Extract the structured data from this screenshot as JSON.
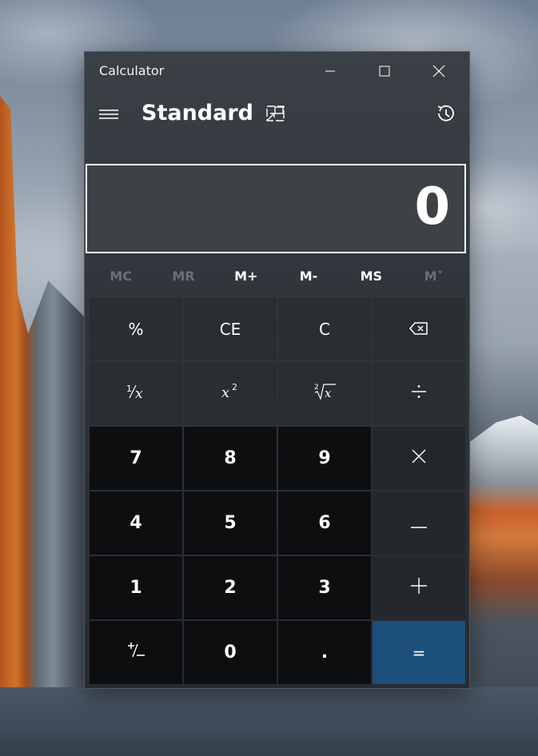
{
  "window": {
    "title": "Calculator",
    "mode": "Standard"
  },
  "display": {
    "value": "0"
  },
  "memory": {
    "mc": "MC",
    "mr": "MR",
    "m_plus": "M+",
    "m_minus": "M-",
    "ms": "MS",
    "m_list": "M˅"
  },
  "keys": {
    "percent": "%",
    "ce": "CE",
    "c": "C",
    "seven": "7",
    "eight": "8",
    "nine": "9",
    "four": "4",
    "five": "5",
    "six": "6",
    "one": "1",
    "two": "2",
    "three": "3",
    "zero": "0",
    "decimal": ".",
    "equals": "="
  },
  "icons": {
    "hamburger": "hamburger-icon",
    "keep_on_top": "keep-on-top-icon",
    "history": "history-icon",
    "minimize": "minimize-icon",
    "maximize": "maximize-icon",
    "close": "close-icon",
    "backspace": "backspace-icon"
  },
  "colors": {
    "accent": "#1c4f7c",
    "window_bg": "#30353b",
    "number_key_bg": "#0d0e10",
    "function_key_bg": "#2a2e33"
  }
}
